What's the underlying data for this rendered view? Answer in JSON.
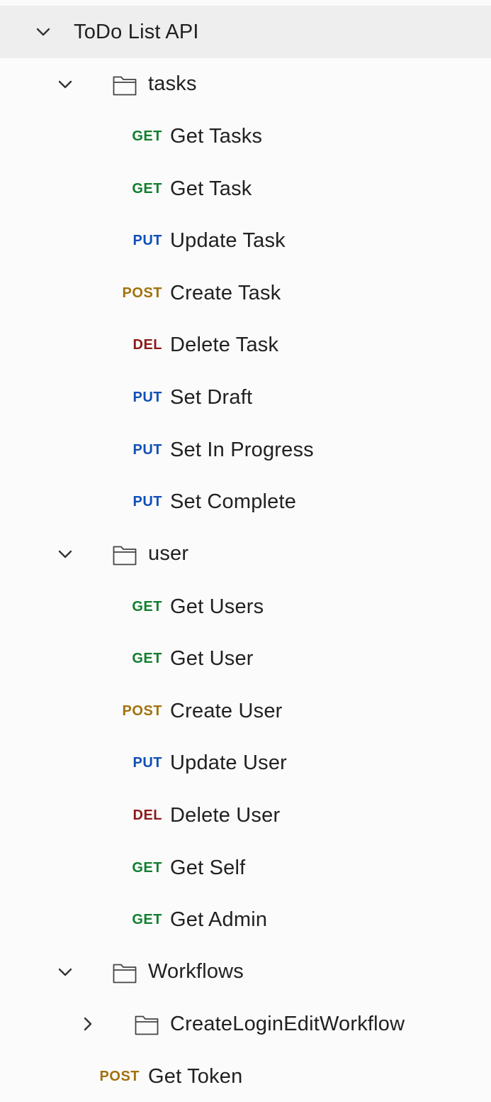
{
  "collection": {
    "name": "ToDo List API"
  },
  "folders": {
    "tasks": {
      "name": "tasks",
      "requests": [
        {
          "method": "GET",
          "name": "Get Tasks"
        },
        {
          "method": "GET",
          "name": "Get Task"
        },
        {
          "method": "PUT",
          "name": "Update Task"
        },
        {
          "method": "POST",
          "name": "Create Task"
        },
        {
          "method": "DEL",
          "name": "Delete Task"
        },
        {
          "method": "PUT",
          "name": "Set Draft"
        },
        {
          "method": "PUT",
          "name": "Set In Progress"
        },
        {
          "method": "PUT",
          "name": "Set Complete"
        }
      ]
    },
    "user": {
      "name": "user",
      "requests": [
        {
          "method": "GET",
          "name": "Get Users"
        },
        {
          "method": "GET",
          "name": "Get User"
        },
        {
          "method": "POST",
          "name": "Create User"
        },
        {
          "method": "PUT",
          "name": "Update User"
        },
        {
          "method": "DEL",
          "name": "Delete User"
        },
        {
          "method": "GET",
          "name": "Get Self"
        },
        {
          "method": "GET",
          "name": "Get Admin"
        }
      ]
    },
    "workflows": {
      "name": "Workflows",
      "subfolder": {
        "name": "CreateLoginEditWorkflow"
      }
    }
  },
  "root_request": {
    "method": "POST",
    "name": "Get Token"
  },
  "colors": {
    "GET": "#117e2f",
    "PUT": "#0f4fb8",
    "POST": "#a1720d",
    "DEL": "#8b1a1a"
  }
}
